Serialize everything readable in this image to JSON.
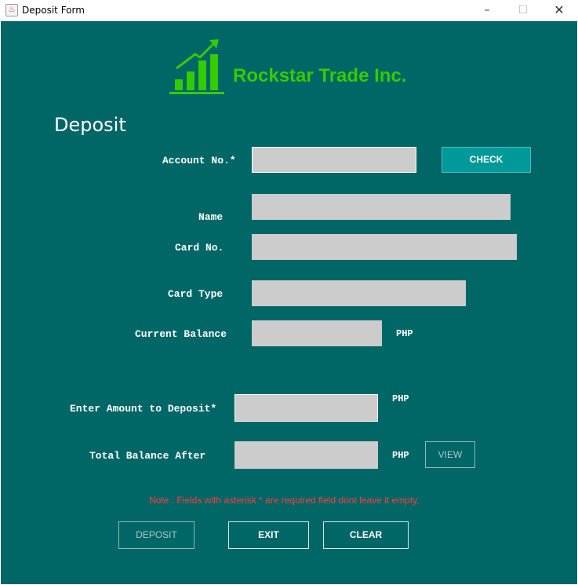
{
  "window": {
    "title": "Deposit Form",
    "app_icon": "java-cup-icon",
    "minimize": "–",
    "maximize": "☐",
    "close": "✕"
  },
  "brand": {
    "name": "Rockstar Trade Inc.",
    "logo_icon": "growth-chart-icon",
    "color": "#33cc00"
  },
  "page": {
    "heading": "Deposit",
    "background": "#006666"
  },
  "form": {
    "account_label": "Account No.*",
    "account_value": "",
    "check_label": "CHECK",
    "name_label": "Name",
    "name_value": "",
    "card_no_label": "Card No.",
    "card_no_value": "",
    "card_type_label": "Card Type",
    "card_type_value": "",
    "current_balance_label": "Current Balance",
    "current_balance_value": "",
    "currency_1": "PHP",
    "deposit_label": "Enter Amount to Deposit*",
    "deposit_value": "",
    "currency_2": "PHP",
    "total_label": "Total Balance After",
    "total_value": "",
    "currency_3": "PHP",
    "view_label": "VIEW"
  },
  "note": "Note : Fields with asterisk * are required field dont leave it empty.",
  "actions": {
    "deposit_label": "DEPOSIT",
    "exit_label": "EXIT",
    "clear_label": "CLEAR"
  }
}
